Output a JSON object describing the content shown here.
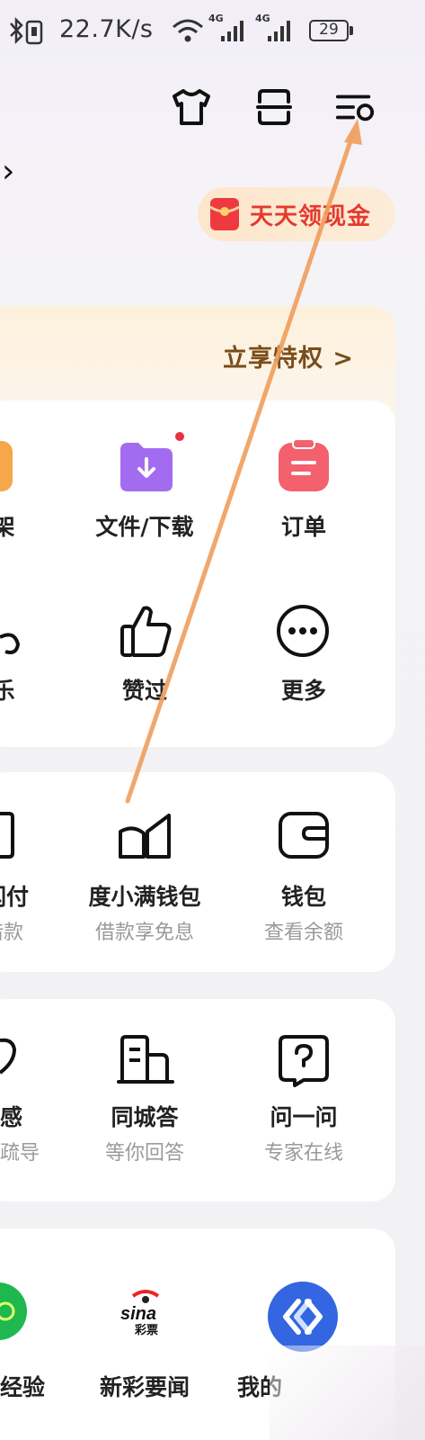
{
  "status_bar": {
    "network_speed": "22.7K/s",
    "signal_1": "4G",
    "signal_2": "4G",
    "battery": "29"
  },
  "header": {
    "icons": [
      "tshirt-skin-icon",
      "scan-icon",
      "settings-icon"
    ],
    "cash_reward_label": "天天领现金"
  },
  "vip_banner": {
    "cta_label": "立享特权 >"
  },
  "tools": {
    "row1": [
      {
        "label": "架",
        "icon": "bookshelf-icon"
      },
      {
        "label": "文件/下载",
        "icon": "download-folder-icon"
      },
      {
        "label": "订单",
        "icon": "order-icon"
      }
    ],
    "row2": [
      {
        "label": "乐",
        "icon": "music-icon"
      },
      {
        "label": "赞过",
        "icon": "thumbs-up-icon"
      },
      {
        "label": "更多",
        "icon": "more-icon"
      }
    ]
  },
  "finance": [
    {
      "label": "闪付",
      "sub": "借款",
      "icon": "pay-icon"
    },
    {
      "label": "度小满钱包",
      "sub": "借款享免息",
      "icon": "duxiaoman-icon"
    },
    {
      "label": "钱包",
      "sub": "查看余额",
      "icon": "wallet-icon"
    }
  ],
  "qa": [
    {
      "label": "感",
      "sub": "疏导",
      "icon": "heart-icon"
    },
    {
      "label": "同城答",
      "sub": "等你回答",
      "icon": "building-icon"
    },
    {
      "label": "问一问",
      "sub": "专家在线",
      "icon": "question-icon"
    }
  ],
  "apps": [
    {
      "label": "经验",
      "icon": "experience-icon"
    },
    {
      "label": "新彩要闻",
      "icon": "sina-lottery-icon",
      "logo_text": "sina 彩票"
    },
    {
      "label": "我的",
      "icon": "blue-app-icon"
    }
  ],
  "colors": {
    "accent_red": "#e43a2d",
    "vip_gold": "#7a4c1a",
    "folder_purple": "#a36cf0",
    "order_red": "#f2616d",
    "app_green": "#1fb84f",
    "app_blue": "#3366e0",
    "annotation_arrow": "#f0a060"
  }
}
